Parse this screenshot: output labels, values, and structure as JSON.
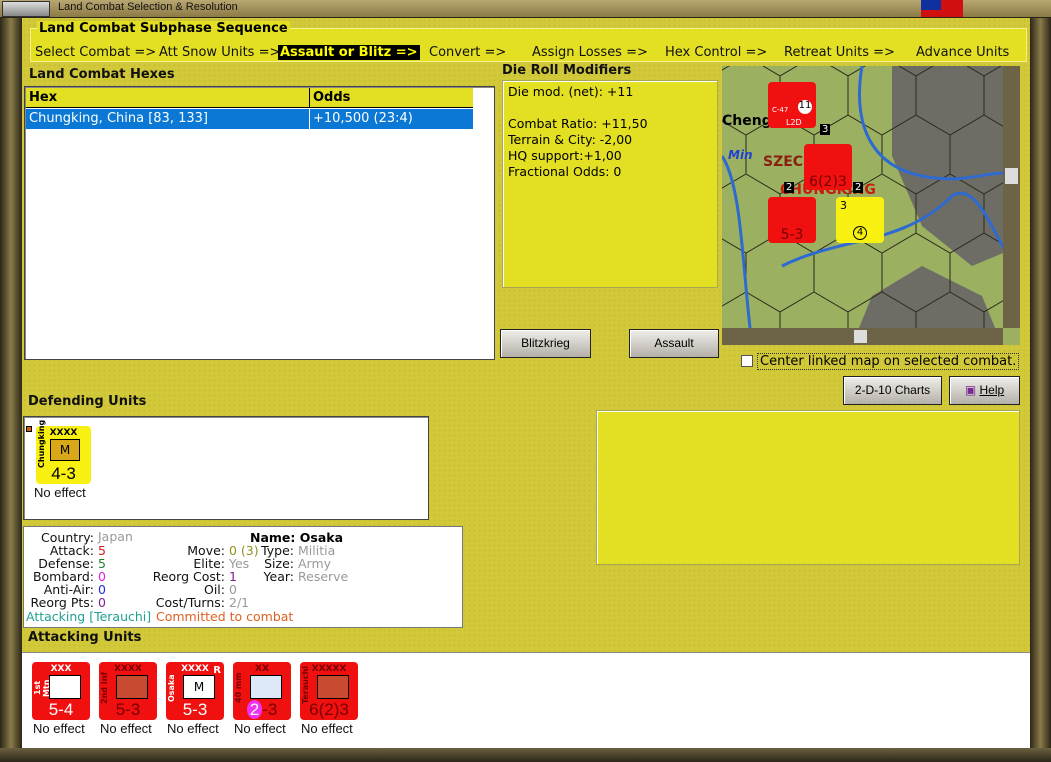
{
  "window": {
    "title": "Land Combat Selection & Resolution"
  },
  "subphase": {
    "title": "Land Combat Subphase Sequence",
    "steps": [
      "Select Combat =>",
      "Att Snow Units =>",
      "Assault or Blitz =>",
      "Convert =>",
      "Assign Losses =>",
      "Hex Control =>",
      "Retreat Units =>",
      "Advance Units"
    ],
    "active_index": 2
  },
  "hexes": {
    "title": "Land Combat Hexes",
    "columns": [
      "Hex",
      "Odds"
    ],
    "rows": [
      {
        "hex": "Chungking, China [83, 133]",
        "odds": "+10,500 (23:4)",
        "selected": true
      }
    ]
  },
  "die_roll": {
    "title": "Die Roll Modifiers",
    "lines": [
      "Die mod. (net): +11",
      "",
      "Combat Ratio: +11,50",
      "Terrain & City: -2,00",
      "HQ support:+1,00",
      "Fractional Odds: 0"
    ]
  },
  "buttons": {
    "blitzkrieg": "Blitzkrieg",
    "assault": "Assault",
    "charts": "2-D-10 Charts",
    "help": "Help"
  },
  "map": {
    "labels": [
      "Chengtu",
      "Min",
      "SZECHWAN",
      "CHUNGKING"
    ],
    "counters": [
      {
        "strength": "5-3",
        "size": "XXXX"
      },
      {
        "strength": "6(2)3",
        "size": "XXXXX"
      },
      {
        "strength": "L2D",
        "type": "C-47",
        "number": "11"
      },
      {
        "strength": "4",
        "stack": "3"
      }
    ],
    "stack_badges": [
      "3",
      "2",
      "2"
    ]
  },
  "center_map": {
    "label": "Center linked map on selected combat.",
    "checked": false
  },
  "defending": {
    "title": "Defending Units",
    "units": [
      {
        "name": "Chungking",
        "size": "XXXX",
        "symbol": "M",
        "strength": "4-3",
        "effect": "No effect",
        "color": "#f8f010"
      }
    ]
  },
  "info": {
    "country_label": "Country:",
    "country": "Japan",
    "attack_label": "Attack:",
    "attack": "5",
    "defense_label": "Defense:",
    "defense": "5",
    "bombard_label": "Bombard:",
    "bombard": "0",
    "antiair_label": "Anti-Air:",
    "antiair": "0",
    "reorgpts_label": "Reorg Pts:",
    "reorgpts": "0",
    "name_label": "Name:",
    "name": "Osaka",
    "move_label": "Move:",
    "move": "0 (3)",
    "elite_label": "Elite:",
    "elite": "Yes",
    "reorgcost_label": "Reorg Cost:",
    "reorgcost": "1",
    "oil_label": "Oil:",
    "oil": "0",
    "costturns_label": "Cost/Turns:",
    "costturns": "2/1",
    "type_label": "Type:",
    "type": "Militia",
    "size_label": "Size:",
    "size": "Army",
    "year_label": "Year:",
    "year": "Reserve",
    "status_attacking": "Attacking [Terauchi]",
    "status_committed": "Committed to combat"
  },
  "attacking": {
    "title": "Attacking Units",
    "units": [
      {
        "name": "1st Mtn",
        "size": "XXX",
        "symbol": "mountain",
        "strength": "5-4",
        "effect": "No effect"
      },
      {
        "name": "2nd Inf",
        "size": "XXXX",
        "symbol": "infantry",
        "strength": "5-3",
        "effect": "No effect"
      },
      {
        "name": "Osaka",
        "size": "XXXX",
        "symbol": "M",
        "strength": "5-3",
        "effect": "No effect",
        "mark": "R"
      },
      {
        "name": "40 mm",
        "size": "XX",
        "symbol": "anti-air",
        "strength_a": "2",
        "strength_b": "-3",
        "effect": "No effect"
      },
      {
        "name": "Terauchi",
        "size": "XXXXX",
        "symbol": "infantry",
        "strength": "6(2)3",
        "effect": "No effect"
      }
    ]
  },
  "colors": {
    "panel": "#e3df22",
    "background": "#d2c93a",
    "selection": "#0a78d4",
    "counter_red": "#f01010"
  }
}
